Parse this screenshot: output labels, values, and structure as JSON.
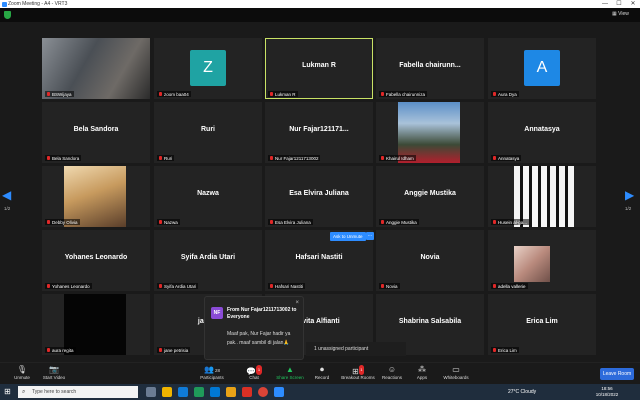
{
  "window": {
    "title": "Zoom Meeting - A4 - VRT3",
    "controls": [
      "—",
      "☐",
      "✕"
    ]
  },
  "meeting": {
    "view_label": "View"
  },
  "participants": [
    {
      "name": "BSWijaya",
      "display": "",
      "type": "photo"
    },
    {
      "name": "zoom baa04",
      "display": "",
      "type": "avatar",
      "initial": "Z",
      "color": "#1fa3a3"
    },
    {
      "name": "Lukman R",
      "display": "Lukman R",
      "type": "name",
      "active": true
    },
    {
      "name": "Fabella chairunniza",
      "display": "Fabella chairunn...",
      "type": "name"
    },
    {
      "name": "Aura Dya",
      "display": "",
      "type": "avatar",
      "initial": "A",
      "color": "#1e88e5"
    },
    {
      "name": "Bela Sandora",
      "display": "Bela Sandora",
      "type": "name"
    },
    {
      "name": "Ruri",
      "display": "Ruri",
      "type": "name"
    },
    {
      "name": "Nur Fajar1211713002",
      "display": "Nur Fajar121171...",
      "type": "name"
    },
    {
      "name": "Khairul Idham",
      "display": "",
      "type": "photo"
    },
    {
      "name": "Annatasya",
      "display": "Annatasya",
      "type": "name"
    },
    {
      "name": "Debby Olivia",
      "display": "",
      "type": "photo"
    },
    {
      "name": "Nazwa",
      "display": "Nazwa",
      "type": "name"
    },
    {
      "name": "Esa Elvira Juliana",
      "display": "Esa Elvira Juliana",
      "type": "name"
    },
    {
      "name": "Anggie Mustika",
      "display": "Anggie Mustika",
      "type": "name"
    },
    {
      "name": "Husein al-ga...",
      "display": "",
      "type": "photo"
    },
    {
      "name": "Yohanes Leonardo",
      "display": "Yohanes Leonardo",
      "type": "name"
    },
    {
      "name": "Syifa Ardia Utari",
      "display": "Syifa Ardia Utari",
      "type": "name"
    },
    {
      "name": "Hafsari Nastiti",
      "display": "Hafsari Nastiti",
      "type": "name"
    },
    {
      "name": "Novia",
      "display": "Novia",
      "type": "name"
    },
    {
      "name": "adella vallerie",
      "display": "",
      "type": "photo"
    },
    {
      "name": "aura regita",
      "display": "",
      "type": "dark"
    },
    {
      "name": "jane petrisia",
      "display": "jane p",
      "type": "name"
    },
    {
      "name": "",
      "display": "evita Alfianti",
      "type": "name"
    },
    {
      "name": "Salsabila",
      "display": "Shabrina Salsabila",
      "type": "name"
    },
    {
      "name": "Erica Lim",
      "display": "Erica Lim",
      "type": "name"
    }
  ],
  "nav": {
    "left_page": "1/2",
    "right_page": "1/2"
  },
  "ask_to_unmute": {
    "label": "Ask to Unmute",
    "more": "..."
  },
  "chat_popup": {
    "initials": "NF",
    "from": "From Nur Fajar1211713002 to Everyone",
    "message": "Maaf pak, Nur Fajar hadir ya pak.. maaf sambil di jalan🙏",
    "close": "×"
  },
  "breakout": {
    "unassigned": "1 unassigned participant"
  },
  "toolbar": {
    "unmute": "Unmute",
    "start_video": "Start Video",
    "participants": "Participants",
    "participants_count": "28",
    "chat": "Chat",
    "chat_badge": "1",
    "share_screen": "Share Screen",
    "record": "Record",
    "breakout_rooms": "Breakout Rooms",
    "breakout_badge": "1",
    "reactions": "Reactions",
    "apps": "Apps",
    "whiteboards": "Whiteboards",
    "leave": "Leave Room"
  },
  "taskbar": {
    "search_placeholder": "Type here to search",
    "weather": "27°C  Cloudy",
    "time": "18:56",
    "date": "10/18/2022"
  }
}
